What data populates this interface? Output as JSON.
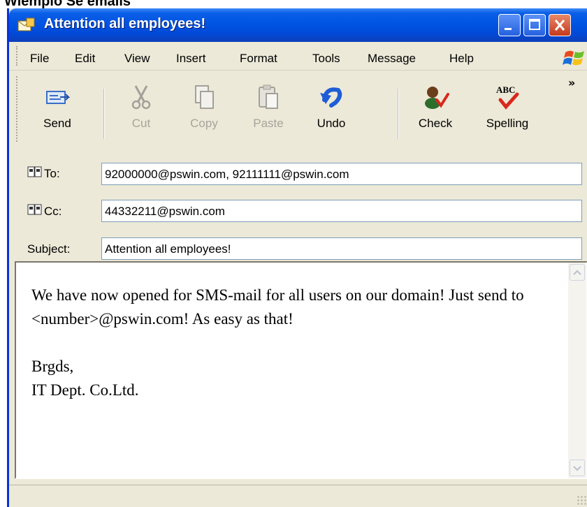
{
  "screen": {
    "top_label": "Wiemplo  Se emails"
  },
  "window": {
    "title": "Attention all employees!"
  },
  "menu": [
    {
      "label": "File"
    },
    {
      "label": "Edit"
    },
    {
      "label": "View"
    },
    {
      "label": "Insert"
    },
    {
      "label": "Format"
    },
    {
      "label": "Tools"
    },
    {
      "label": "Message"
    },
    {
      "label": "Help"
    }
  ],
  "toolbar": {
    "send": "Send",
    "cut": "Cut",
    "copy": "Copy",
    "paste": "Paste",
    "undo": "Undo",
    "check": "Check",
    "spelling": "Spelling",
    "spelling_icon_text": "ABC"
  },
  "fields": {
    "to_label": "To:",
    "to_value": "92000000@pswin.com, 92111111@pswin.com",
    "cc_label": "Cc:",
    "cc_value": "44332211@pswin.com",
    "subject_label": "Subject:",
    "subject_value": "Attention all employees!"
  },
  "body": {
    "paragraph1": "We have now opened for SMS-mail for all users on our domain! Just send to <number>@pswin.com! As easy as that!",
    "signoff": "Brgds,",
    "signature": "IT Dept. Co.Ltd."
  },
  "icons": {
    "titlebar": "envelope-icon",
    "send": "send-icon",
    "cut": "scissors-icon",
    "copy": "copy-icon",
    "paste": "paste-icon",
    "undo": "undo-icon",
    "check": "check-names-icon",
    "spelling": "spelling-icon",
    "address_book": "address-book-icon"
  },
  "colors": {
    "titlebar": "#0054e3",
    "close_button": "#c5391b",
    "window_bg": "#ece9d8"
  }
}
